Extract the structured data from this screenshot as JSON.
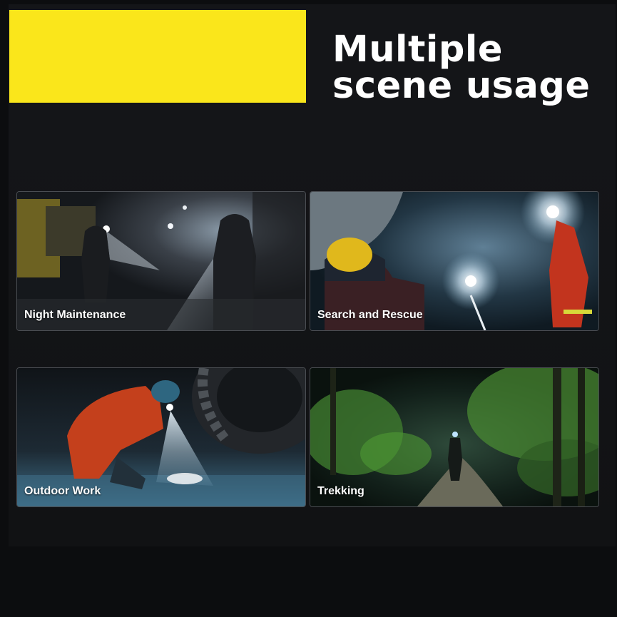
{
  "header": {
    "title_line1": "Multiple",
    "title_line2": "scene usage",
    "accent_color": "#fae61b"
  },
  "scenes": [
    {
      "label": "Night Maintenance"
    },
    {
      "label": "Search and Rescue"
    },
    {
      "label": "Outdoor Work"
    },
    {
      "label": "Trekking"
    }
  ]
}
